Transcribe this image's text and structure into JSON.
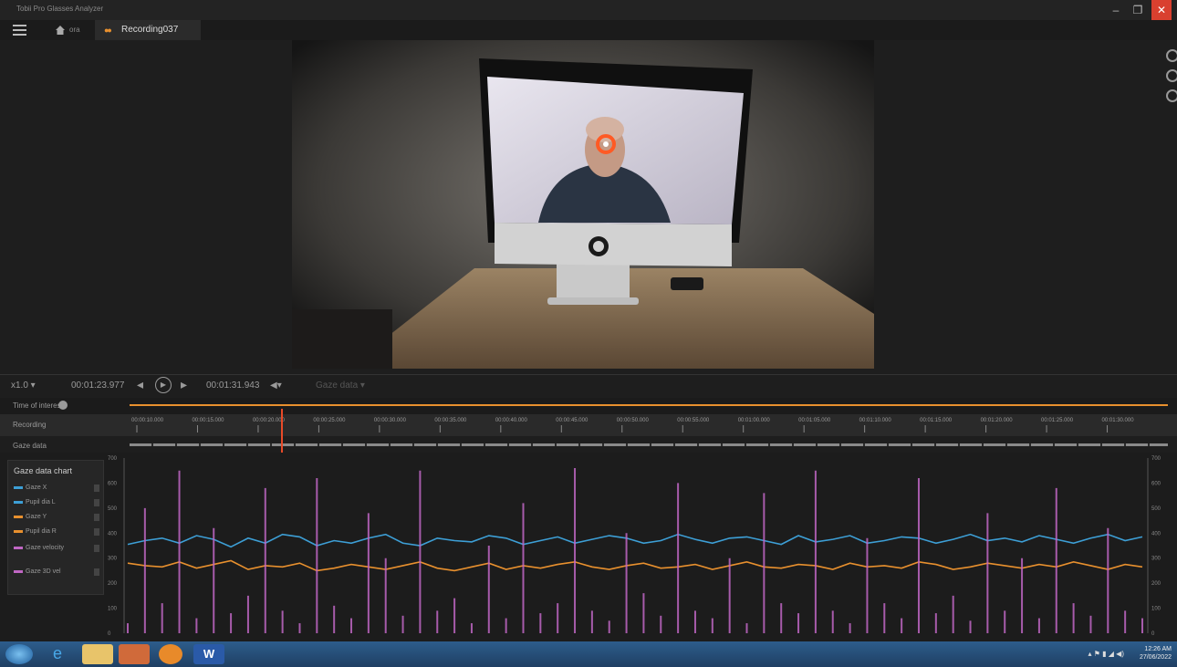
{
  "app": {
    "title": "Tobii Pro Glasses Analyzer",
    "window_controls": {
      "minimize": "‒",
      "restore": "❐",
      "close": "✕"
    }
  },
  "tabs": {
    "home_label": "ora",
    "recording_label": "Recording037"
  },
  "colors": {
    "accent_orange": "#e8902e",
    "gaze_marker": "#ff5a24",
    "series_pupil_left": "#3d9fd6",
    "series_pupil_right": "#e8902e",
    "series_velocity": "#c067c4",
    "close_button": "#d9402f",
    "taskbar": "#2a578a"
  },
  "controls": {
    "speed": "x1.0 ▾",
    "current_time": "00:01:23.977",
    "prev": "◂",
    "play": "▶",
    "next": "▸",
    "end_time": "00:01:31.943",
    "volume": "◀▾",
    "events": "Gaze data ▾"
  },
  "timeline": {
    "row1_label": "Time of interest",
    "row2_label": "Recording",
    "row3_label": "Gaze data",
    "ticks": [
      "00:00:10.000",
      "00:00:15.000",
      "00:00:20.000",
      "00:00:25.000",
      "00:00:30.000",
      "00:00:35.000",
      "00:00:40.000",
      "00:00:45.000",
      "00:00:50.000",
      "00:00:55.000",
      "00:01:00.000",
      "00:01:05.000",
      "00:01:10.000",
      "00:01:15.000",
      "00:01:20.000",
      "00:01:25.000",
      "00:01:30.000"
    ]
  },
  "legend": {
    "header": "Gaze data chart",
    "items": [
      {
        "label": "Gaze X",
        "color": "#3d9fd6"
      },
      {
        "label": "Pupil dia L",
        "color": "#3d9fd6"
      },
      {
        "label": "Gaze Y",
        "color": "#e8902e"
      },
      {
        "label": "Pupil dia R",
        "color": "#e8902e"
      },
      {
        "label": "Gaze velocity",
        "color": "#c067c4"
      },
      {
        "label": "Gaze 3D vel",
        "color": "#c067c4"
      }
    ]
  },
  "chart_data": {
    "type": "line",
    "title": "",
    "xlabel": "",
    "ylabel": "",
    "ylim": [
      0,
      700
    ],
    "y_ticks": [
      0,
      100,
      200,
      300,
      400,
      500,
      600,
      700
    ],
    "series": [
      {
        "color": "#3d9fd6",
        "values": [
          355,
          370,
          380,
          360,
          390,
          375,
          345,
          380,
          360,
          395,
          385,
          350,
          370,
          360,
          380,
          395,
          360,
          350,
          380,
          370,
          365,
          390,
          380,
          355,
          370,
          385,
          360,
          375,
          390,
          380,
          360,
          370,
          395,
          375,
          360,
          380,
          385,
          370,
          355,
          390,
          365,
          375,
          390,
          360,
          370,
          385,
          380,
          360,
          375,
          395,
          370,
          380,
          365,
          390,
          375,
          360,
          380,
          395,
          370,
          385
        ]
      },
      {
        "color": "#e8902e",
        "values": [
          280,
          270,
          265,
          285,
          260,
          275,
          290,
          255,
          270,
          265,
          280,
          250,
          260,
          275,
          265,
          255,
          270,
          285,
          260,
          250,
          265,
          280,
          255,
          270,
          260,
          275,
          285,
          265,
          255,
          270,
          280,
          260,
          265,
          275,
          255,
          270,
          285,
          265,
          260,
          275,
          270,
          255,
          280,
          265,
          270,
          260,
          285,
          275,
          255,
          265,
          280,
          270,
          260,
          275,
          265,
          285,
          270,
          255,
          275,
          265
        ]
      },
      {
        "color": "#c067c4",
        "values": [
          40,
          500,
          120,
          650,
          60,
          420,
          80,
          150,
          580,
          90,
          40,
          620,
          110,
          60,
          480,
          300,
          70,
          650,
          90,
          140,
          40,
          350,
          60,
          520,
          80,
          120,
          660,
          90,
          50,
          400,
          160,
          70,
          600,
          90,
          60,
          300,
          40,
          560,
          120,
          80,
          650,
          90,
          40,
          380,
          120,
          60,
          620,
          80,
          150,
          50,
          480,
          90,
          300,
          60,
          580,
          120,
          70,
          420,
          90,
          60
        ]
      }
    ]
  },
  "taskbar": {
    "clock_time": "12:26 AM",
    "clock_date": "27/06/2022"
  }
}
